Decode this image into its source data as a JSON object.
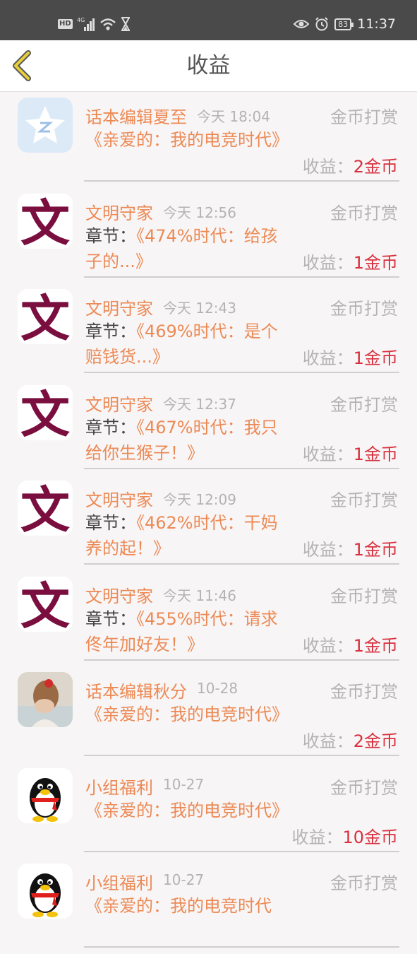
{
  "status_bar": {
    "time": "11:37",
    "battery": "83",
    "network": "4G"
  },
  "header": {
    "title": "收益"
  },
  "items": [
    {
      "avatar": "qq-zone-star-icon",
      "name": "话本编辑夏至",
      "time": "今天 18:04",
      "type": "金币打赏",
      "prefix": "",
      "content": "《亲爱的：我的电竞时代》",
      "income_label": "收益：",
      "income_value": "2金币"
    },
    {
      "avatar": "wen-character-icon",
      "name": "文明守家",
      "time": "今天 12:56",
      "type": "金币打赏",
      "prefix": "章节：",
      "content": "《474%时代：给孩子的...》",
      "income_label": "收益：",
      "income_value": "1金币"
    },
    {
      "avatar": "wen-character-icon",
      "name": "文明守家",
      "time": "今天 12:43",
      "type": "金币打赏",
      "prefix": "章节：",
      "content": "《469%时代：是个赔钱货...》",
      "income_label": "收益：",
      "income_value": "1金币"
    },
    {
      "avatar": "wen-character-icon",
      "name": "文明守家",
      "time": "今天 12:37",
      "type": "金币打赏",
      "prefix": "章节：",
      "content": "《467%时代：我只给你生猴子！》",
      "income_label": "收益：",
      "income_value": "1金币"
    },
    {
      "avatar": "wen-character-icon",
      "name": "文明守家",
      "time": "今天 12:09",
      "type": "金币打赏",
      "prefix": "章节：",
      "content": "《462%时代：干妈养的起！》",
      "income_label": "收益：",
      "income_value": "1金币"
    },
    {
      "avatar": "wen-character-icon",
      "name": "文明守家",
      "time": "今天 11:46",
      "type": "金币打赏",
      "prefix": "章节：",
      "content": "《455%时代：请求佟年加好友！》",
      "income_label": "收益：",
      "income_value": "1金币"
    },
    {
      "avatar": "girl-photo-avatar",
      "name": "话本编辑秋分",
      "time": "10-28",
      "type": "金币打赏",
      "prefix": "",
      "content": "《亲爱的：我的电竞时代》",
      "income_label": "收益：",
      "income_value": "2金币"
    },
    {
      "avatar": "qq-penguin-icon",
      "name": "小组福利",
      "time": "10-27",
      "type": "金币打赏",
      "prefix": "",
      "content": "《亲爱的：我的电竞时代》",
      "income_label": "收益：",
      "income_value": "10金币"
    },
    {
      "avatar": "qq-penguin-icon",
      "name": "小组福利",
      "time": "10-27",
      "type": "金币打赏",
      "prefix": "",
      "content": "《亲爱的：我的电竞时代",
      "income_label": "",
      "income_value": ""
    }
  ]
}
